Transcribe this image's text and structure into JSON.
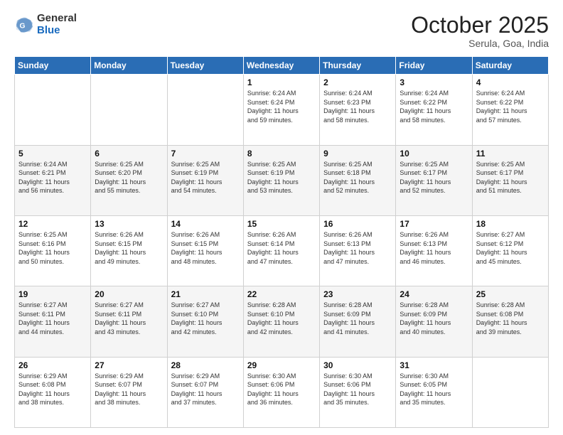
{
  "header": {
    "logo_general": "General",
    "logo_blue": "Blue",
    "month_title": "October 2025",
    "location": "Serula, Goa, India"
  },
  "days_of_week": [
    "Sunday",
    "Monday",
    "Tuesday",
    "Wednesday",
    "Thursday",
    "Friday",
    "Saturday"
  ],
  "weeks": [
    [
      {
        "day": "",
        "info": ""
      },
      {
        "day": "",
        "info": ""
      },
      {
        "day": "",
        "info": ""
      },
      {
        "day": "1",
        "info": "Sunrise: 6:24 AM\nSunset: 6:24 PM\nDaylight: 11 hours\nand 59 minutes."
      },
      {
        "day": "2",
        "info": "Sunrise: 6:24 AM\nSunset: 6:23 PM\nDaylight: 11 hours\nand 58 minutes."
      },
      {
        "day": "3",
        "info": "Sunrise: 6:24 AM\nSunset: 6:22 PM\nDaylight: 11 hours\nand 58 minutes."
      },
      {
        "day": "4",
        "info": "Sunrise: 6:24 AM\nSunset: 6:22 PM\nDaylight: 11 hours\nand 57 minutes."
      }
    ],
    [
      {
        "day": "5",
        "info": "Sunrise: 6:24 AM\nSunset: 6:21 PM\nDaylight: 11 hours\nand 56 minutes."
      },
      {
        "day": "6",
        "info": "Sunrise: 6:25 AM\nSunset: 6:20 PM\nDaylight: 11 hours\nand 55 minutes."
      },
      {
        "day": "7",
        "info": "Sunrise: 6:25 AM\nSunset: 6:19 PM\nDaylight: 11 hours\nand 54 minutes."
      },
      {
        "day": "8",
        "info": "Sunrise: 6:25 AM\nSunset: 6:19 PM\nDaylight: 11 hours\nand 53 minutes."
      },
      {
        "day": "9",
        "info": "Sunrise: 6:25 AM\nSunset: 6:18 PM\nDaylight: 11 hours\nand 52 minutes."
      },
      {
        "day": "10",
        "info": "Sunrise: 6:25 AM\nSunset: 6:17 PM\nDaylight: 11 hours\nand 52 minutes."
      },
      {
        "day": "11",
        "info": "Sunrise: 6:25 AM\nSunset: 6:17 PM\nDaylight: 11 hours\nand 51 minutes."
      }
    ],
    [
      {
        "day": "12",
        "info": "Sunrise: 6:25 AM\nSunset: 6:16 PM\nDaylight: 11 hours\nand 50 minutes."
      },
      {
        "day": "13",
        "info": "Sunrise: 6:26 AM\nSunset: 6:15 PM\nDaylight: 11 hours\nand 49 minutes."
      },
      {
        "day": "14",
        "info": "Sunrise: 6:26 AM\nSunset: 6:15 PM\nDaylight: 11 hours\nand 48 minutes."
      },
      {
        "day": "15",
        "info": "Sunrise: 6:26 AM\nSunset: 6:14 PM\nDaylight: 11 hours\nand 47 minutes."
      },
      {
        "day": "16",
        "info": "Sunrise: 6:26 AM\nSunset: 6:13 PM\nDaylight: 11 hours\nand 47 minutes."
      },
      {
        "day": "17",
        "info": "Sunrise: 6:26 AM\nSunset: 6:13 PM\nDaylight: 11 hours\nand 46 minutes."
      },
      {
        "day": "18",
        "info": "Sunrise: 6:27 AM\nSunset: 6:12 PM\nDaylight: 11 hours\nand 45 minutes."
      }
    ],
    [
      {
        "day": "19",
        "info": "Sunrise: 6:27 AM\nSunset: 6:11 PM\nDaylight: 11 hours\nand 44 minutes."
      },
      {
        "day": "20",
        "info": "Sunrise: 6:27 AM\nSunset: 6:11 PM\nDaylight: 11 hours\nand 43 minutes."
      },
      {
        "day": "21",
        "info": "Sunrise: 6:27 AM\nSunset: 6:10 PM\nDaylight: 11 hours\nand 42 minutes."
      },
      {
        "day": "22",
        "info": "Sunrise: 6:28 AM\nSunset: 6:10 PM\nDaylight: 11 hours\nand 42 minutes."
      },
      {
        "day": "23",
        "info": "Sunrise: 6:28 AM\nSunset: 6:09 PM\nDaylight: 11 hours\nand 41 minutes."
      },
      {
        "day": "24",
        "info": "Sunrise: 6:28 AM\nSunset: 6:09 PM\nDaylight: 11 hours\nand 40 minutes."
      },
      {
        "day": "25",
        "info": "Sunrise: 6:28 AM\nSunset: 6:08 PM\nDaylight: 11 hours\nand 39 minutes."
      }
    ],
    [
      {
        "day": "26",
        "info": "Sunrise: 6:29 AM\nSunset: 6:08 PM\nDaylight: 11 hours\nand 38 minutes."
      },
      {
        "day": "27",
        "info": "Sunrise: 6:29 AM\nSunset: 6:07 PM\nDaylight: 11 hours\nand 38 minutes."
      },
      {
        "day": "28",
        "info": "Sunrise: 6:29 AM\nSunset: 6:07 PM\nDaylight: 11 hours\nand 37 minutes."
      },
      {
        "day": "29",
        "info": "Sunrise: 6:30 AM\nSunset: 6:06 PM\nDaylight: 11 hours\nand 36 minutes."
      },
      {
        "day": "30",
        "info": "Sunrise: 6:30 AM\nSunset: 6:06 PM\nDaylight: 11 hours\nand 35 minutes."
      },
      {
        "day": "31",
        "info": "Sunrise: 6:30 AM\nSunset: 6:05 PM\nDaylight: 11 hours\nand 35 minutes."
      },
      {
        "day": "",
        "info": ""
      }
    ]
  ]
}
